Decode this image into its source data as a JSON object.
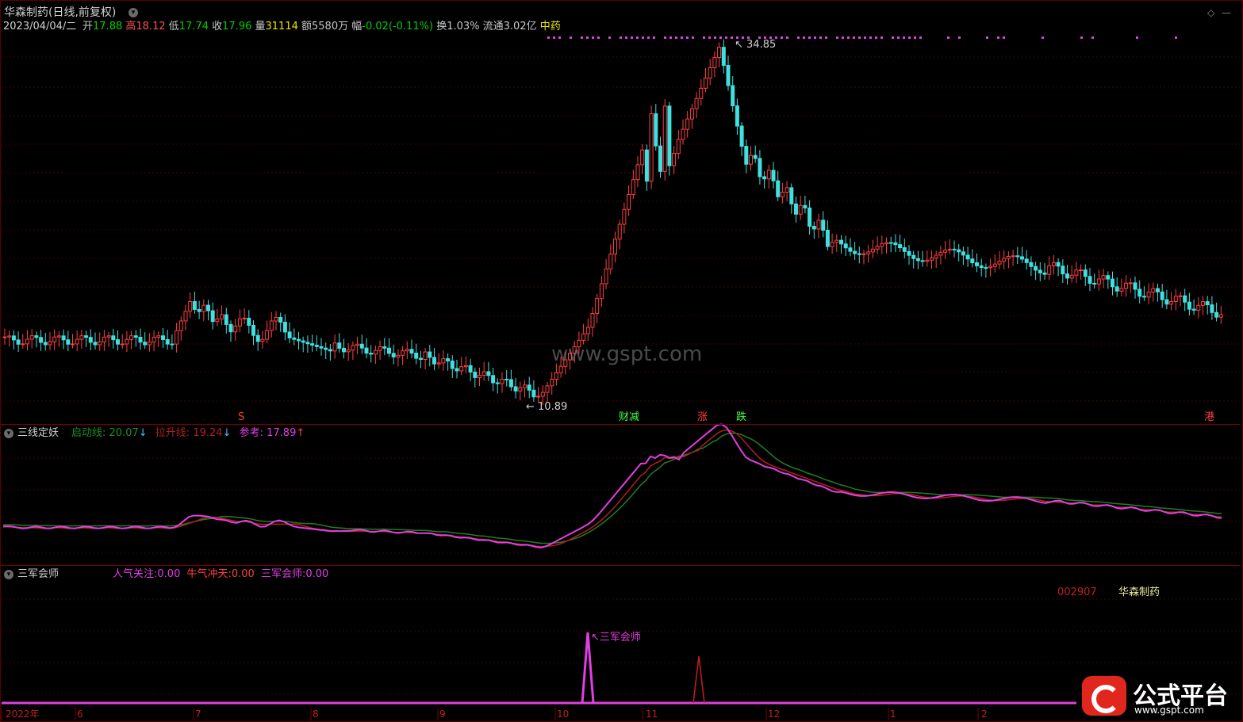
{
  "header": {
    "title": "华森制药(日线,前复权)",
    "date": "2023/04/04/二",
    "open_label": "开",
    "open": "17.88",
    "high_label": "高",
    "high": "18.12",
    "low_label": "低",
    "low": "17.74",
    "close_label": "收",
    "close": "17.96",
    "vol_label": "量",
    "vol": "31114",
    "amount": "额5580万",
    "change_label": "幅",
    "change": "-0.02(-0.11%)",
    "turnover": "换1.03%",
    "float": "流通3.02亿",
    "sector": "中药"
  },
  "main_panel": {
    "max_label": "34.85",
    "min_label": "10.89",
    "markers": [
      "S",
      "财减",
      "涨",
      "跌",
      "港"
    ],
    "watermark": "www.gspt.com"
  },
  "panel2": {
    "name": "三线定妖",
    "line1_label": "启动线:",
    "line1_value": "20.07",
    "line2_label": "拉升线:",
    "line2_value": "19.24",
    "line3_label": "参考:",
    "line3_value": "17.89"
  },
  "panel3": {
    "name": "三军会师",
    "l1": "人气关注:",
    "v1": "0.00",
    "l2": "牛气冲天:",
    "v2": "0.00",
    "l3": "三军会师:",
    "v3": "0.00",
    "code": "002907",
    "stock": "华森制药",
    "signal_label": "三军会师"
  },
  "x_axis": [
    "2022年",
    "6",
    "7",
    "8",
    "9",
    "10",
    "11",
    "12",
    "1",
    "2"
  ],
  "logo": {
    "title": "公式平台",
    "url": "www.gspt.com"
  },
  "colors": {
    "up": "#ff4444",
    "down": "#40e0e0",
    "green": "#00d000",
    "magenta": "#e040e0"
  }
}
